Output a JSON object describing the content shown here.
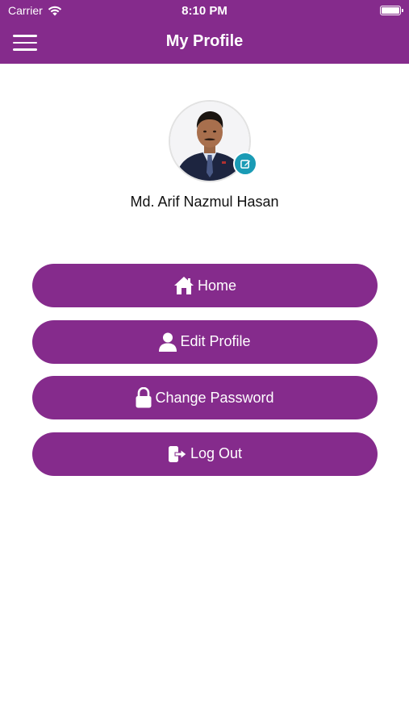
{
  "status_bar": {
    "carrier": "Carrier",
    "time": "8:10 PM"
  },
  "header": {
    "title": "My Profile"
  },
  "profile": {
    "name": "Md. Arif Nazmul Hasan"
  },
  "menu": {
    "items": [
      {
        "label": "Home",
        "icon": "home-icon"
      },
      {
        "label": "Edit Profile",
        "icon": "user-icon"
      },
      {
        "label": "Change Password",
        "icon": "lock-icon"
      },
      {
        "label": "Log Out",
        "icon": "logout-icon"
      }
    ]
  },
  "colors": {
    "primary": "#852b8c",
    "badge": "#1a9bb5",
    "text": "#111111",
    "background": "#ffffff"
  }
}
